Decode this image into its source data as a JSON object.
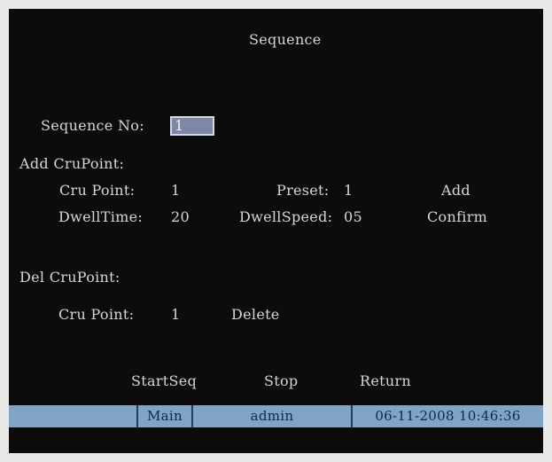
{
  "title": "Sequence",
  "sequence_no": {
    "label": "Sequence No:",
    "value": "1"
  },
  "add_section": {
    "heading": "Add CruPoint:",
    "cru_point_label": "Cru Point:",
    "cru_point_value": "1",
    "preset_label": "Preset:",
    "preset_value": "1",
    "add_button": "Add",
    "dwell_time_label": "DwellTime:",
    "dwell_time_value": "20",
    "dwell_speed_label": "DwellSpeed:",
    "dwell_speed_value": "05",
    "confirm_button": "Confirm"
  },
  "del_section": {
    "heading": "Del CruPoint:",
    "cru_point_label": "Cru Point:",
    "cru_point_value": "1",
    "delete_button": "Delete"
  },
  "actions": {
    "start_seq": "StartSeq",
    "stop": "Stop",
    "return": "Return"
  },
  "status_bar": {
    "menu": "Main",
    "user": "admin",
    "datetime": "06-11-2008 10:46:36"
  },
  "colors": {
    "background": "#0c0c0c",
    "text": "#d6d6d6",
    "input_fill": "#7e87a8",
    "status_bar": "#7fa4c6"
  }
}
